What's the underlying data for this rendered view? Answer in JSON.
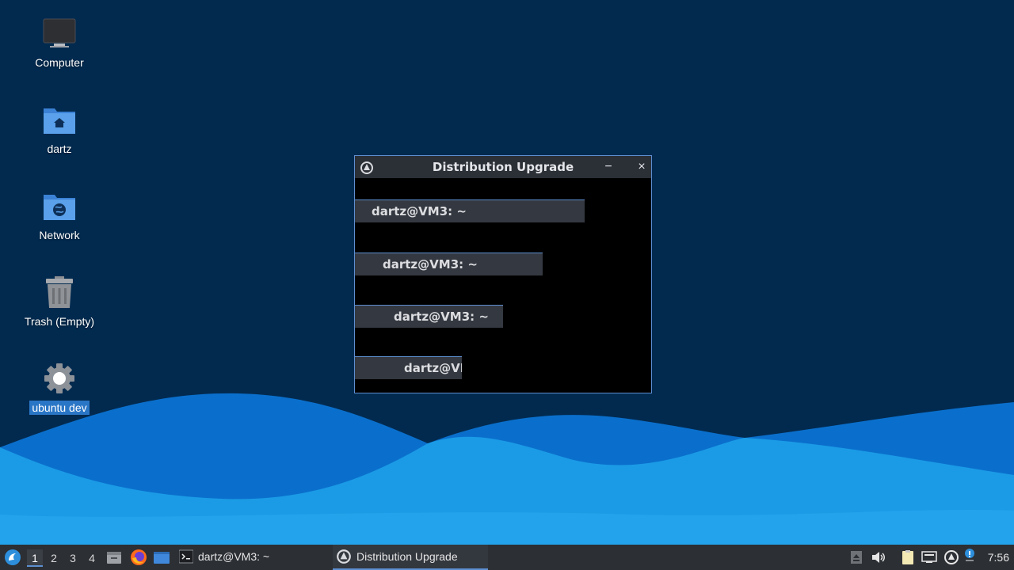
{
  "desktop": {
    "icons": [
      {
        "label": "Computer",
        "icon": "monitor-icon"
      },
      {
        "label": "dartz",
        "icon": "home-folder-icon"
      },
      {
        "label": "Network",
        "icon": "network-folder-icon"
      },
      {
        "label": "Trash (Empty)",
        "icon": "trash-icon"
      },
      {
        "label": "ubuntu dev",
        "icon": "gear-icon",
        "selected": true
      }
    ]
  },
  "window": {
    "title": "Distribution Upgrade",
    "minimize_glyph": "−",
    "close_glyph": "×",
    "ghost_bars": [
      {
        "label": "dartz@VM3: ~"
      },
      {
        "label": "dartz@VM3: ~"
      },
      {
        "label": "dartz@VM3: ~"
      },
      {
        "label": "dartz@VI"
      }
    ]
  },
  "taskbar": {
    "workspaces": [
      "1",
      "2",
      "3",
      "4"
    ],
    "active_workspace": "1",
    "tasks": [
      {
        "label": "dartz@VM3: ~",
        "icon": "terminal-icon"
      },
      {
        "label": "Distribution Upgrade",
        "icon": "upgrade-icon",
        "active": true
      }
    ],
    "clock": "7:56"
  },
  "colors": {
    "desktop_bg": "#022a4f",
    "wave_light": "#1e9fe8",
    "wave_mid": "#0a72cc",
    "accent": "#5d8fd1",
    "taskbar_bg": "#2c2f34"
  }
}
